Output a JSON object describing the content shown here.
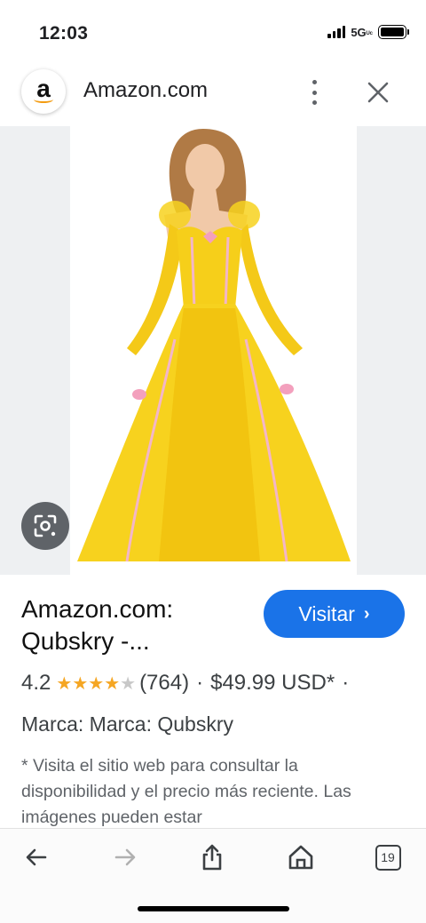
{
  "status": {
    "time": "12:03",
    "network": "5G",
    "network_suffix": "ᵁᶜ"
  },
  "header": {
    "logo_letter": "a",
    "title": "Amazon.com"
  },
  "result": {
    "title_line1": "Amazon.com:",
    "title_line2": "Qubskry -...",
    "visit_label": "Visitar",
    "rating": "4.2",
    "stars_filled": 4,
    "stars_total": 5,
    "review_count": "(764)",
    "separator": "·",
    "price": "$49.99 USD*",
    "trailing_dot": "·",
    "brand": "Marca: Marca: Qubskry",
    "disclaimer": "* Visita el sitio web para consultar la disponibilidad y el precio más reciente. Las imágenes pueden estar"
  },
  "toolbar": {
    "tab_count": "19"
  },
  "colors": {
    "accent": "#1a73e8",
    "star": "#f5a623",
    "gown": "#f7d21e"
  }
}
